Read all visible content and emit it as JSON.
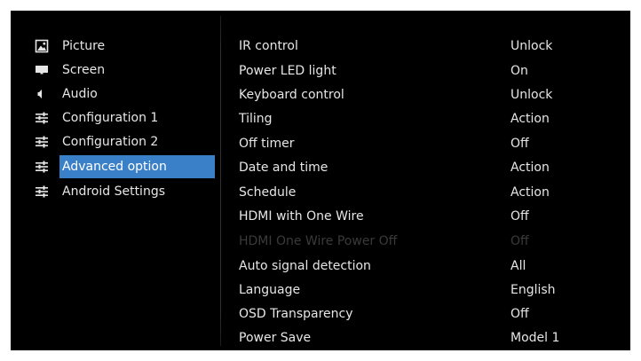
{
  "menu": {
    "items": [
      {
        "label": "Picture",
        "icon": "picture-icon",
        "selected": false
      },
      {
        "label": "Screen",
        "icon": "screen-icon",
        "selected": false
      },
      {
        "label": "Audio",
        "icon": "speaker-icon",
        "selected": false
      },
      {
        "label": "Configuration 1",
        "icon": "sliders-icon",
        "selected": false
      },
      {
        "label": "Configuration 2",
        "icon": "sliders-icon",
        "selected": false
      },
      {
        "label": "Advanced option",
        "icon": "sliders-icon",
        "selected": true
      },
      {
        "label": "Android Settings",
        "icon": "sliders-icon",
        "selected": false
      }
    ]
  },
  "settings": {
    "rows": [
      {
        "label": "IR control",
        "value": "Unlock",
        "enabled": true
      },
      {
        "label": "Power LED light",
        "value": "On",
        "enabled": true
      },
      {
        "label": "Keyboard control",
        "value": "Unlock",
        "enabled": true
      },
      {
        "label": "Tiling",
        "value": "Action",
        "enabled": true
      },
      {
        "label": "Off timer",
        "value": "Off",
        "enabled": true
      },
      {
        "label": "Date and time",
        "value": "Action",
        "enabled": true
      },
      {
        "label": "Schedule",
        "value": "Action",
        "enabled": true
      },
      {
        "label": "HDMI with One Wire",
        "value": "Off",
        "enabled": true
      },
      {
        "label": "HDMI One Wire Power Off",
        "value": "Off",
        "enabled": false
      },
      {
        "label": "Auto signal detection",
        "value": "All",
        "enabled": true
      },
      {
        "label": "Language",
        "value": "English",
        "enabled": true
      },
      {
        "label": "OSD Transparency",
        "value": "Off",
        "enabled": true
      },
      {
        "label": "Power Save",
        "value": "Model 1",
        "enabled": true
      }
    ]
  },
  "colors": {
    "background": "#000000",
    "text": "#e6e6e6",
    "selected_highlight": "#3a80c8",
    "disabled_text": "#3a3a3a"
  }
}
